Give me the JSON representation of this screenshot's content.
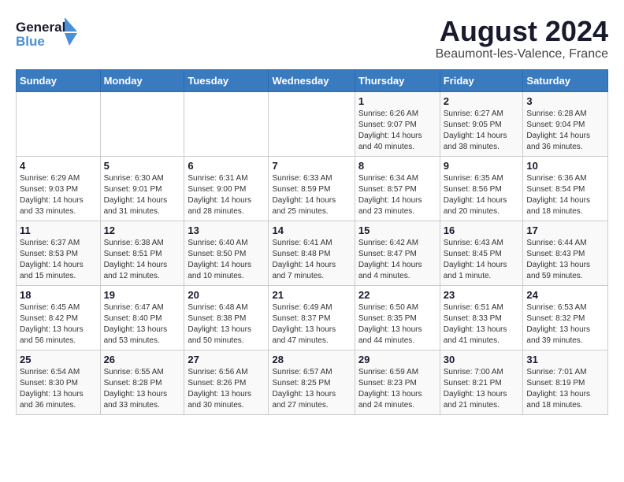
{
  "header": {
    "logo_line1": "General",
    "logo_line2": "Blue",
    "title": "August 2024",
    "subtitle": "Beaumont-les-Valence, France"
  },
  "days_of_week": [
    "Sunday",
    "Monday",
    "Tuesday",
    "Wednesday",
    "Thursday",
    "Friday",
    "Saturday"
  ],
  "weeks": [
    [
      {
        "day": "",
        "info": ""
      },
      {
        "day": "",
        "info": ""
      },
      {
        "day": "",
        "info": ""
      },
      {
        "day": "",
        "info": ""
      },
      {
        "day": "1",
        "info": "Sunrise: 6:26 AM\nSunset: 9:07 PM\nDaylight: 14 hours\nand 40 minutes."
      },
      {
        "day": "2",
        "info": "Sunrise: 6:27 AM\nSunset: 9:05 PM\nDaylight: 14 hours\nand 38 minutes."
      },
      {
        "day": "3",
        "info": "Sunrise: 6:28 AM\nSunset: 9:04 PM\nDaylight: 14 hours\nand 36 minutes."
      }
    ],
    [
      {
        "day": "4",
        "info": "Sunrise: 6:29 AM\nSunset: 9:03 PM\nDaylight: 14 hours\nand 33 minutes."
      },
      {
        "day": "5",
        "info": "Sunrise: 6:30 AM\nSunset: 9:01 PM\nDaylight: 14 hours\nand 31 minutes."
      },
      {
        "day": "6",
        "info": "Sunrise: 6:31 AM\nSunset: 9:00 PM\nDaylight: 14 hours\nand 28 minutes."
      },
      {
        "day": "7",
        "info": "Sunrise: 6:33 AM\nSunset: 8:59 PM\nDaylight: 14 hours\nand 25 minutes."
      },
      {
        "day": "8",
        "info": "Sunrise: 6:34 AM\nSunset: 8:57 PM\nDaylight: 14 hours\nand 23 minutes."
      },
      {
        "day": "9",
        "info": "Sunrise: 6:35 AM\nSunset: 8:56 PM\nDaylight: 14 hours\nand 20 minutes."
      },
      {
        "day": "10",
        "info": "Sunrise: 6:36 AM\nSunset: 8:54 PM\nDaylight: 14 hours\nand 18 minutes."
      }
    ],
    [
      {
        "day": "11",
        "info": "Sunrise: 6:37 AM\nSunset: 8:53 PM\nDaylight: 14 hours\nand 15 minutes."
      },
      {
        "day": "12",
        "info": "Sunrise: 6:38 AM\nSunset: 8:51 PM\nDaylight: 14 hours\nand 12 minutes."
      },
      {
        "day": "13",
        "info": "Sunrise: 6:40 AM\nSunset: 8:50 PM\nDaylight: 14 hours\nand 10 minutes."
      },
      {
        "day": "14",
        "info": "Sunrise: 6:41 AM\nSunset: 8:48 PM\nDaylight: 14 hours\nand 7 minutes."
      },
      {
        "day": "15",
        "info": "Sunrise: 6:42 AM\nSunset: 8:47 PM\nDaylight: 14 hours\nand 4 minutes."
      },
      {
        "day": "16",
        "info": "Sunrise: 6:43 AM\nSunset: 8:45 PM\nDaylight: 14 hours\nand 1 minute."
      },
      {
        "day": "17",
        "info": "Sunrise: 6:44 AM\nSunset: 8:43 PM\nDaylight: 13 hours\nand 59 minutes."
      }
    ],
    [
      {
        "day": "18",
        "info": "Sunrise: 6:45 AM\nSunset: 8:42 PM\nDaylight: 13 hours\nand 56 minutes."
      },
      {
        "day": "19",
        "info": "Sunrise: 6:47 AM\nSunset: 8:40 PM\nDaylight: 13 hours\nand 53 minutes."
      },
      {
        "day": "20",
        "info": "Sunrise: 6:48 AM\nSunset: 8:38 PM\nDaylight: 13 hours\nand 50 minutes."
      },
      {
        "day": "21",
        "info": "Sunrise: 6:49 AM\nSunset: 8:37 PM\nDaylight: 13 hours\nand 47 minutes."
      },
      {
        "day": "22",
        "info": "Sunrise: 6:50 AM\nSunset: 8:35 PM\nDaylight: 13 hours\nand 44 minutes."
      },
      {
        "day": "23",
        "info": "Sunrise: 6:51 AM\nSunset: 8:33 PM\nDaylight: 13 hours\nand 41 minutes."
      },
      {
        "day": "24",
        "info": "Sunrise: 6:53 AM\nSunset: 8:32 PM\nDaylight: 13 hours\nand 39 minutes."
      }
    ],
    [
      {
        "day": "25",
        "info": "Sunrise: 6:54 AM\nSunset: 8:30 PM\nDaylight: 13 hours\nand 36 minutes."
      },
      {
        "day": "26",
        "info": "Sunrise: 6:55 AM\nSunset: 8:28 PM\nDaylight: 13 hours\nand 33 minutes."
      },
      {
        "day": "27",
        "info": "Sunrise: 6:56 AM\nSunset: 8:26 PM\nDaylight: 13 hours\nand 30 minutes."
      },
      {
        "day": "28",
        "info": "Sunrise: 6:57 AM\nSunset: 8:25 PM\nDaylight: 13 hours\nand 27 minutes."
      },
      {
        "day": "29",
        "info": "Sunrise: 6:59 AM\nSunset: 8:23 PM\nDaylight: 13 hours\nand 24 minutes."
      },
      {
        "day": "30",
        "info": "Sunrise: 7:00 AM\nSunset: 8:21 PM\nDaylight: 13 hours\nand 21 minutes."
      },
      {
        "day": "31",
        "info": "Sunrise: 7:01 AM\nSunset: 8:19 PM\nDaylight: 13 hours\nand 18 minutes."
      }
    ]
  ]
}
